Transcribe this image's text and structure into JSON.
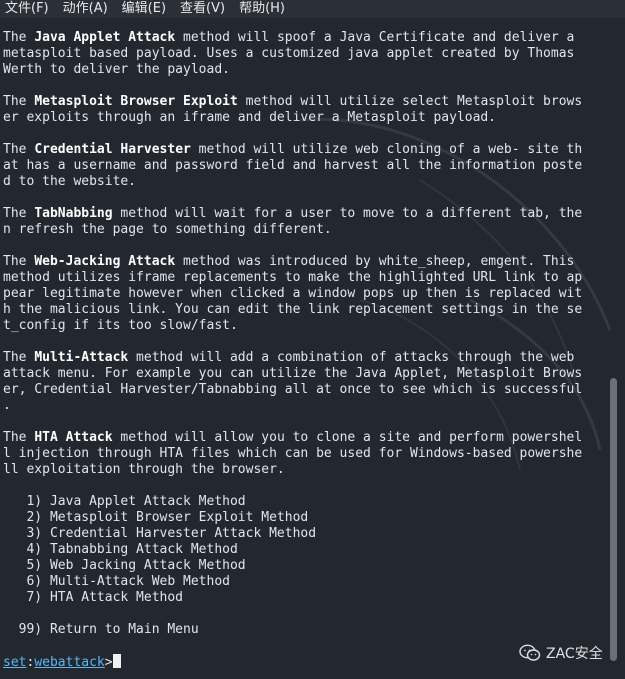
{
  "menubar": {
    "items": [
      {
        "label": "文件(F)"
      },
      {
        "label": "动作(A)"
      },
      {
        "label": "编辑(E)"
      },
      {
        "label": "查看(V)"
      },
      {
        "label": "帮助(H)"
      }
    ]
  },
  "terminal": {
    "paragraphs": [
      {
        "lines": [
          [
            "The ",
            {
              "b": "Java Applet Attack"
            },
            " method will spoof a Java Certificate and deliver a"
          ],
          [
            "metasploit based payload. Uses a customized java applet created by Thomas"
          ],
          [
            "Werth to deliver the payload."
          ]
        ]
      },
      {
        "lines": [
          [
            "The ",
            {
              "b": "Metasploit Browser Exploit"
            },
            " method will utilize select Metasploit brows"
          ],
          [
            "er exploits through an iframe and deliver a Metasploit payload."
          ]
        ]
      },
      {
        "lines": [
          [
            "The ",
            {
              "b": "Credential Harvester"
            },
            " method will utilize web cloning of a web- site th"
          ],
          [
            "at has a username and password field and harvest all the information poste"
          ],
          [
            "d to the website."
          ]
        ]
      },
      {
        "lines": [
          [
            "The ",
            {
              "b": "TabNabbing"
            },
            " method will wait for a user to move to a different tab, the"
          ],
          [
            "n refresh the page to something different."
          ]
        ]
      },
      {
        "lines": [
          [
            "The ",
            {
              "b": "Web-Jacking Attack"
            },
            " method was introduced by white_sheep, emgent. This"
          ],
          [
            "method utilizes iframe replacements to make the highlighted URL link to ap"
          ],
          [
            "pear legitimate however when clicked a window pops up then is replaced wit"
          ],
          [
            "h the malicious link. You can edit the link replacement settings in the se"
          ],
          [
            "t_config if its too slow/fast."
          ]
        ]
      },
      {
        "lines": [
          [
            "The ",
            {
              "b": "Multi-Attack"
            },
            " method will add a combination of attacks through the web"
          ],
          [
            "attack menu. For example you can utilize the Java Applet, Metasploit Brows"
          ],
          [
            "er, Credential Harvester/Tabnabbing all at once to see which is successful"
          ],
          [
            "."
          ]
        ]
      },
      {
        "lines": [
          [
            "The ",
            {
              "b": "HTA Attack"
            },
            " method will allow you to clone a site and perform powershel"
          ],
          [
            "l injection through HTA files which can be used for Windows-based powershe"
          ],
          [
            "ll exploitation through the browser."
          ]
        ]
      }
    ],
    "menu_options": [
      "   1) Java Applet Attack Method",
      "   2) Metasploit Browser Exploit Method",
      "   3) Credential Harvester Attack Method",
      "   4) Tabnabbing Attack Method",
      "   5) Web Jacking Attack Method",
      "   6) Multi-Attack Web Method",
      "   7) HTA Attack Method"
    ],
    "return_option": "  99) Return to Main Menu",
    "prompt": {
      "set": "set",
      "colon": ":",
      "module": "webattack",
      "gt": ">"
    }
  },
  "watermark": {
    "text": "ZAC安全",
    "icon": "wechat-icon"
  },
  "colors": {
    "background": "#23272f",
    "text": "#e3e5e8",
    "prompt_accent": "#5eb6f0"
  }
}
